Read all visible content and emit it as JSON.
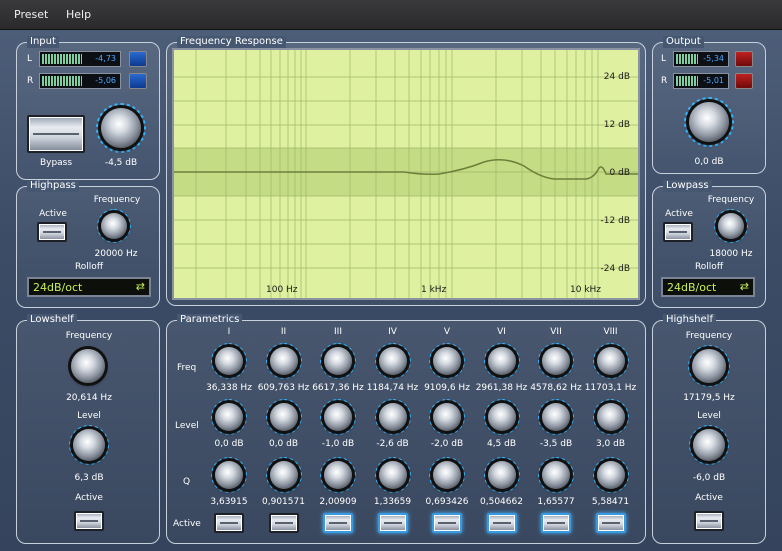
{
  "menu": [
    "Preset",
    "Help"
  ],
  "input": {
    "title": "Input",
    "L": {
      "label": "L",
      "value": "-4,73"
    },
    "R": {
      "label": "R",
      "value": "-5,06"
    },
    "bypass_label": "Bypass",
    "gain_value": "-4,5 dB"
  },
  "output": {
    "title": "Output",
    "L": {
      "label": "L",
      "value": "-5,34"
    },
    "R": {
      "label": "R",
      "value": "-5,01"
    },
    "gain_value": "0,0 dB"
  },
  "highpass": {
    "title": "Highpass",
    "active_label": "Active",
    "frequency_label": "Frequency",
    "frequency_value": "20000 Hz",
    "rolloff_label": "Rolloff",
    "rolloff_value": "24dB/oct"
  },
  "lowpass": {
    "title": "Lowpass",
    "active_label": "Active",
    "frequency_label": "Frequency",
    "frequency_value": "18000 Hz",
    "rolloff_label": "Rolloff",
    "rolloff_value": "24dB/oct"
  },
  "lowshelf": {
    "title": "Lowshelf",
    "frequency_label": "Frequency",
    "frequency_value": "20,614 Hz",
    "level_label": "Level",
    "level_value": "6,3 dB",
    "active_label": "Active"
  },
  "highshelf": {
    "title": "Highshelf",
    "frequency_label": "Frequency",
    "frequency_value": "17179,5 Hz",
    "level_label": "Level",
    "level_value": "-6,0 dB",
    "active_label": "Active"
  },
  "frequency_response": {
    "title": "Frequency Response",
    "db_labels": [
      "24 dB",
      "12 dB",
      "0 dB",
      "-12 dB",
      "-24 dB"
    ],
    "freq_labels": [
      "100 Hz",
      "1 kHz",
      "10 kHz"
    ]
  },
  "parametrics": {
    "title": "Parametrics",
    "row_labels": {
      "freq": "Freq",
      "level": "Level",
      "q": "Q",
      "active": "Active"
    },
    "bands": [
      {
        "name": "I",
        "freq": "36,338 Hz",
        "level": "0,0 dB",
        "q": "3,63915",
        "active": false
      },
      {
        "name": "II",
        "freq": "609,763 Hz",
        "level": "0,0 dB",
        "q": "0,901571",
        "active": false
      },
      {
        "name": "III",
        "freq": "6617,36 Hz",
        "level": "-1,0 dB",
        "q": "2,00909",
        "active": true
      },
      {
        "name": "IV",
        "freq": "1184,74 Hz",
        "level": "-2,6 dB",
        "q": "1,33659",
        "active": true
      },
      {
        "name": "V",
        "freq": "9109,6 Hz",
        "level": "-2,0 dB",
        "q": "0,693426",
        "active": true
      },
      {
        "name": "VI",
        "freq": "2961,38 Hz",
        "level": "4,5 dB",
        "q": "0,504662",
        "active": true
      },
      {
        "name": "VII",
        "freq": "4578,62 Hz",
        "level": "-3,5 dB",
        "q": "1,65577",
        "active": true
      },
      {
        "name": "VIII",
        "freq": "11703,1 Hz",
        "level": "3,0 dB",
        "q": "5,58471",
        "active": true
      }
    ]
  },
  "colors": {
    "graph_bg": "#dff0a0",
    "graph_band": "#c4dc84",
    "accent_blue": "#33b8ff",
    "dropdown_text": "#c8f05a"
  }
}
